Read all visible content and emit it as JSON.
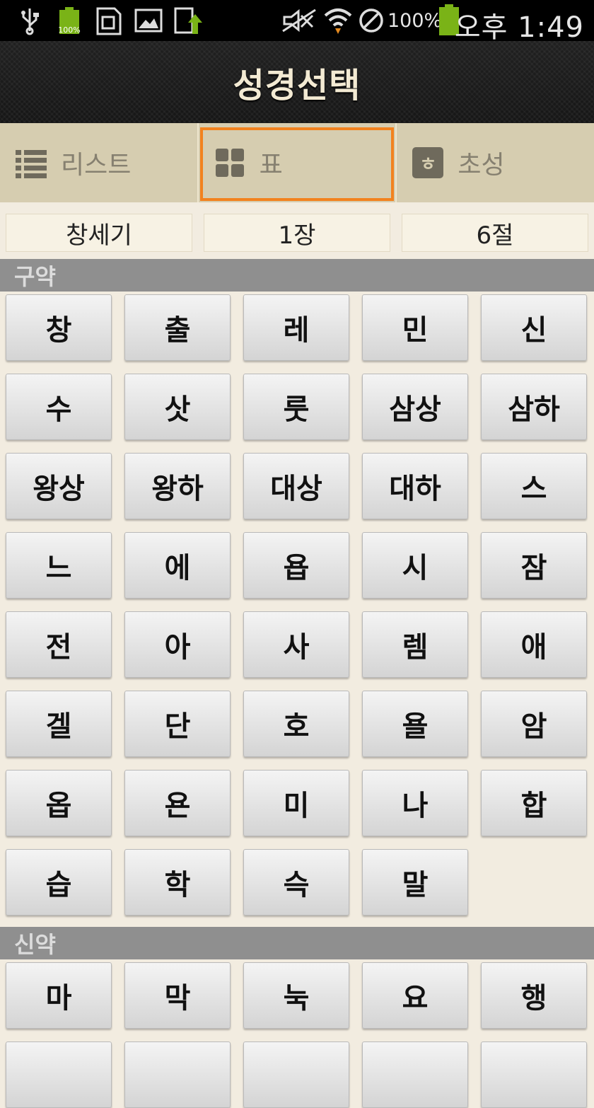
{
  "status_bar": {
    "battery_small_label": "100%",
    "battery_percent": "100%",
    "clock": "오후 1:49",
    "icons": [
      "usb-icon",
      "battery-full-icon",
      "sd-card-icon",
      "image-icon",
      "upload-icon",
      "mute-icon",
      "wifi-icon",
      "no-signal-icon",
      "battery-icon"
    ]
  },
  "header": {
    "title": "성경선택"
  },
  "tabs": [
    {
      "label": "리스트",
      "icon": "list-icon",
      "active": false
    },
    {
      "label": "표",
      "icon": "grid-icon",
      "active": true
    },
    {
      "label": "초성",
      "icon": "hangul-initial-icon",
      "icon_glyph": "ㅎ",
      "active": false
    }
  ],
  "selection": {
    "book": "창세기",
    "chapter": "1장",
    "verse": "6절"
  },
  "sections": [
    {
      "title": "구약",
      "books": [
        "창",
        "출",
        "레",
        "민",
        "신",
        "수",
        "삿",
        "룻",
        "삼상",
        "삼하",
        "왕상",
        "왕하",
        "대상",
        "대하",
        "스",
        "느",
        "에",
        "욥",
        "시",
        "잠",
        "전",
        "아",
        "사",
        "렘",
        "애",
        "겔",
        "단",
        "호",
        "욜",
        "암",
        "옵",
        "욘",
        "미",
        "나",
        "합",
        "습",
        "학",
        "슥",
        "말"
      ]
    },
    {
      "title": "신약",
      "books": [
        "마",
        "막",
        "눅",
        "요",
        "행"
      ]
    }
  ],
  "colors": {
    "accent": "#f2821e",
    "tab_bar": "#d6cdb0",
    "background": "#f2ece0",
    "section_header": "#8f8f8f"
  }
}
